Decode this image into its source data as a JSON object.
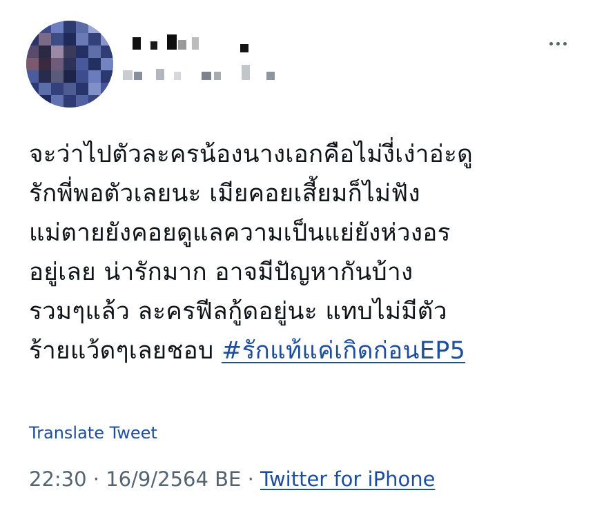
{
  "tweet": {
    "author": {
      "avatar_colors": [
        "#8a9bd0",
        "#3b4a8a",
        "#6d7fc0",
        "#2d3a70",
        "#5a6ca8",
        "#9aa8d8",
        "#4a5a99",
        "#2a3468",
        "#7a6a88",
        "#3e4c86",
        "#1e2a5a",
        "#6a7ab4",
        "#34407a",
        "#8896cc",
        "#5a4a6e",
        "#2a2a44",
        "#9a8aa8",
        "#3a3a5a",
        "#243064",
        "#5e6ea8",
        "#303c74",
        "#7a5a70",
        "#3a2a40",
        "#6e5a7a",
        "#2e3258",
        "#48589a",
        "#223060",
        "#7484c0",
        "#4a5c9c",
        "#262c4e",
        "#5a5a7a",
        "#1e2448",
        "#3c4c8c",
        "#6a7cbc",
        "#2c3870",
        "#2a3a78",
        "#5c6eaa",
        "#34407c",
        "#4e5c94",
        "#28346c",
        "#8090c8",
        "#46549a",
        "#3a4a8e",
        "#20285c",
        "#6272b0",
        "#2e3a74",
        "#5262a0",
        "#3a4682",
        "#7888c4"
      ]
    },
    "menu_icon": "more-horizontal-icon",
    "text_lines": [
      "จะว่าไปตัวละครน้องนางเอกคือไม่งี่เง่าอ่ะดู",
      "รักพี่พอตัวเลยนะ เมียคอยเสี้ยมก็ไม่ฟัง",
      "แม่ตายยังคอยดูแลความเป็นแย่ยังห่วงอร",
      "อยู่เลย น่ารักมาก อาจมีปัญหากันบ้าง",
      "รวมๆแล้ว ละครฟีลกู้ดอยู่นะ แทบไม่มีตัว"
    ],
    "last_line_text": "ร้ายแว้ดๆเลยชอบ ",
    "hashtag": "#รักแท้แค่เกิดก่อนEP5",
    "translate_label": "Translate Tweet",
    "time": "22:30",
    "separator": "·",
    "date": "16/9/2564 BE",
    "source": "Twitter for iPhone",
    "colors": {
      "link": "#1d4e9e",
      "text": "#0f1419",
      "muted": "#536471"
    }
  }
}
